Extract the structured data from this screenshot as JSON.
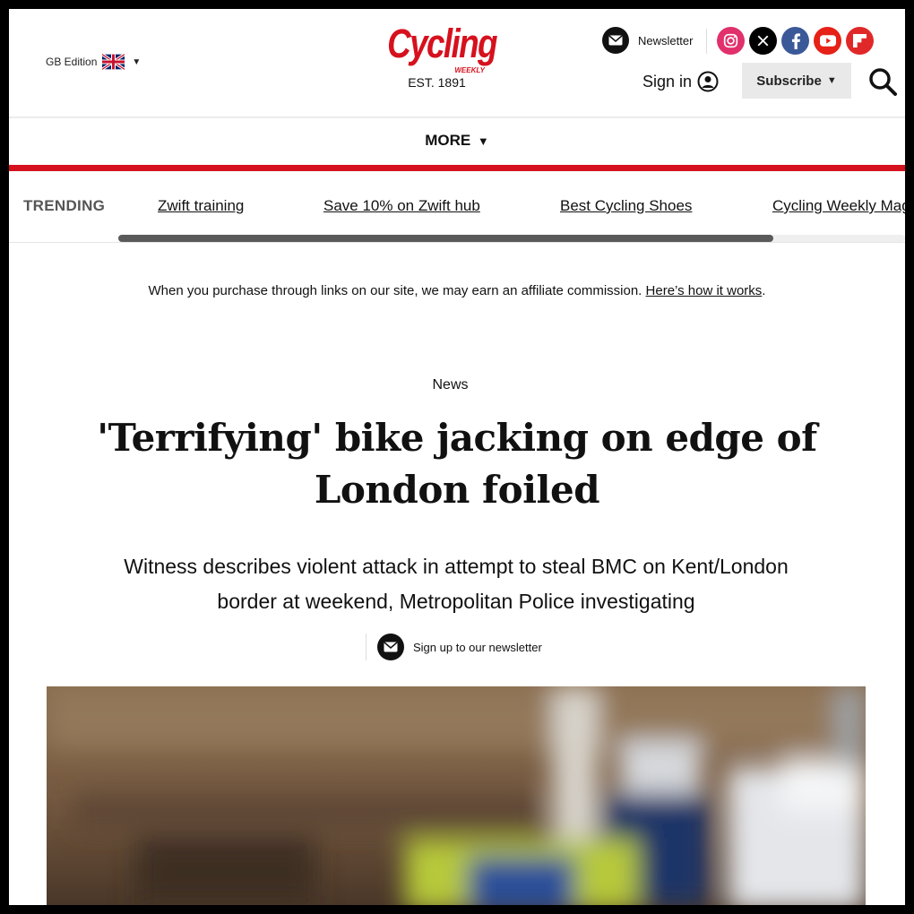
{
  "header": {
    "edition": "GB Edition",
    "logo": {
      "wordmark": "Cycling",
      "sub": "WEEKLY",
      "est": "EST. 1891"
    },
    "newsletter_label": "Newsletter",
    "socials": [
      {
        "name": "instagram",
        "color": "#e1306c"
      },
      {
        "name": "x",
        "color": "#000000"
      },
      {
        "name": "facebook",
        "color": "#3b5998"
      },
      {
        "name": "youtube",
        "color": "#e62117"
      },
      {
        "name": "flipboard",
        "color": "#e12828"
      }
    ],
    "signin_label": "Sign in",
    "subscribe_label": "Subscribe"
  },
  "nav": {
    "more_label": "MORE"
  },
  "trending": {
    "label": "TRENDING",
    "items": [
      "Zwift training",
      "Save 10% on Zwift hub",
      "Best Cycling Shoes",
      "Cycling Weekly Mag"
    ]
  },
  "affiliate": {
    "text": "When you purchase through links on our site, we may earn an affiliate commission.",
    "link": "Here’s how it works",
    "end": "."
  },
  "article": {
    "category": "News",
    "headline_line1": "'Terrifying' bike jacking on edge of",
    "headline_line2": "London foiled",
    "strap_line1": "Witness describes violent attack in attempt to steal BMC on Kent/London",
    "strap_line2": "border at weekend, Metropolitan Police investigating",
    "signup_label": "Sign up to our newsletter"
  },
  "colors": {
    "brand_red": "#d6111e"
  }
}
